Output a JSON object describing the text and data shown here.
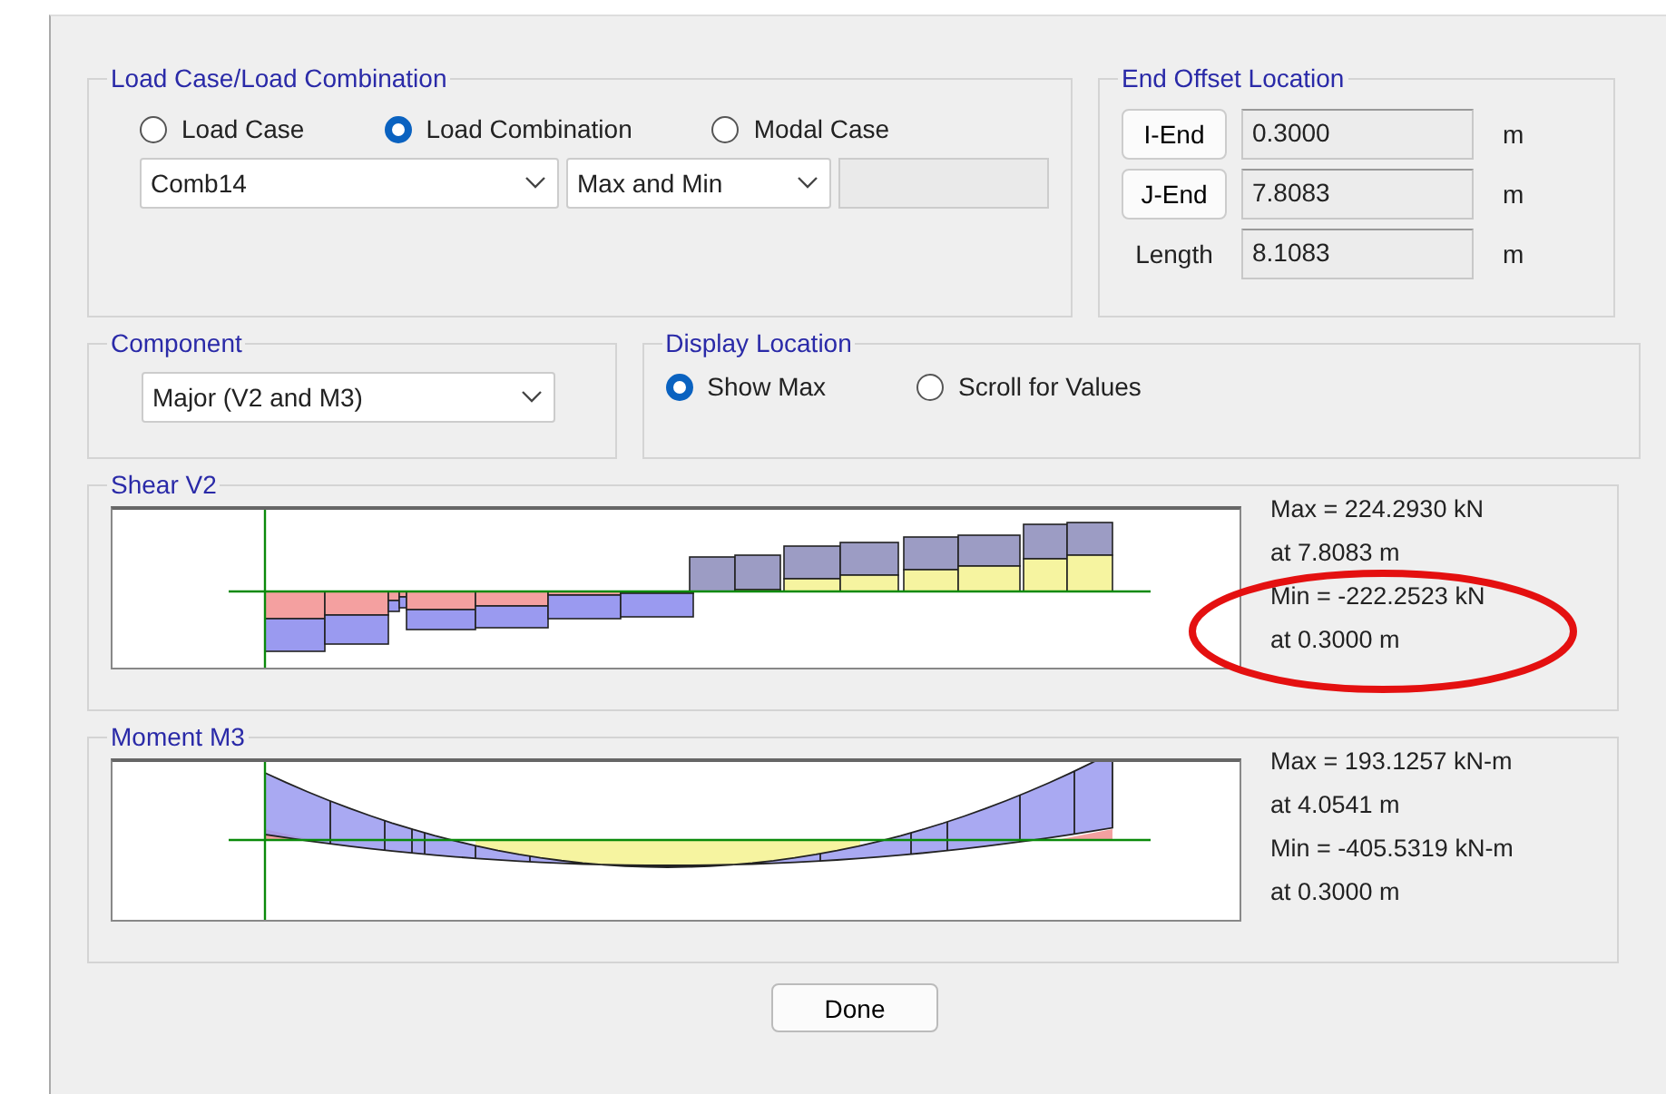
{
  "load_case_group": {
    "title": "Load Case/Load Combination",
    "options": [
      {
        "label": "Load Case",
        "selected": false
      },
      {
        "label": "Load Combination",
        "selected": true
      },
      {
        "label": "Modal Case",
        "selected": false
      }
    ],
    "case_dropdown": "Comb14",
    "type_dropdown": "Max and Min"
  },
  "end_offset": {
    "title": "End Offset Location",
    "rows": [
      {
        "kind": "button",
        "label": "I-End",
        "value": "0.3000",
        "unit": "m"
      },
      {
        "kind": "button",
        "label": "J-End",
        "value": "7.8083",
        "unit": "m"
      },
      {
        "kind": "label",
        "label": "Length",
        "value": "8.1083",
        "unit": "m"
      }
    ]
  },
  "component": {
    "title": "Component",
    "dropdown": "Major (V2 and M3)"
  },
  "display_location": {
    "title": "Display Location",
    "options": [
      {
        "label": "Show Max",
        "selected": true
      },
      {
        "label": "Scroll for Values",
        "selected": false
      }
    ]
  },
  "diagrams": [
    {
      "title": "Shear V2",
      "kind": "shear",
      "readouts": [
        "Max = 224.2930 kN",
        "at 7.8083 m",
        "Min = -222.2523 kN",
        "at 0.3000 m"
      ]
    },
    {
      "title": "Moment M3",
      "kind": "moment",
      "readouts": [
        "Max = 193.1257 kN-m",
        "at 4.0541 m",
        "Min = -405.5319 kN-m",
        "at 0.3000 m"
      ]
    }
  ],
  "buttons": [
    "Done"
  ]
}
